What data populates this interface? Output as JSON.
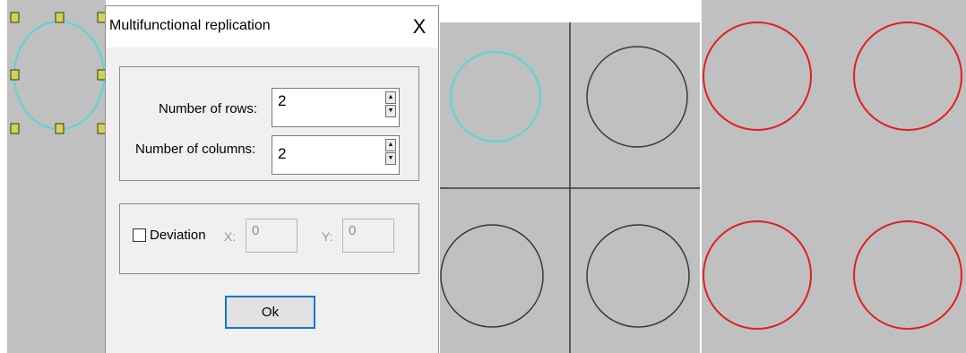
{
  "dialog": {
    "title": "Multifunctional replication",
    "close_glyph": "X",
    "rows_label": "Number of rows:",
    "rows_value": "2",
    "cols_label": "Number of columns:",
    "cols_value": "2",
    "deviation_label": "Deviation",
    "deviation_checked": false,
    "x_label": "X:",
    "x_value": "0",
    "y_label": "Y:",
    "y_value": "0",
    "ok_label": "Ok"
  },
  "colors": {
    "canvas_bg": "#c0c0c0",
    "selected_stroke": "#5ad6d6",
    "normal_stroke": "#3a3a3a",
    "copy_stroke": "#e02020",
    "handle_fill": "#d2d25a",
    "accent": "#0f78d7"
  }
}
